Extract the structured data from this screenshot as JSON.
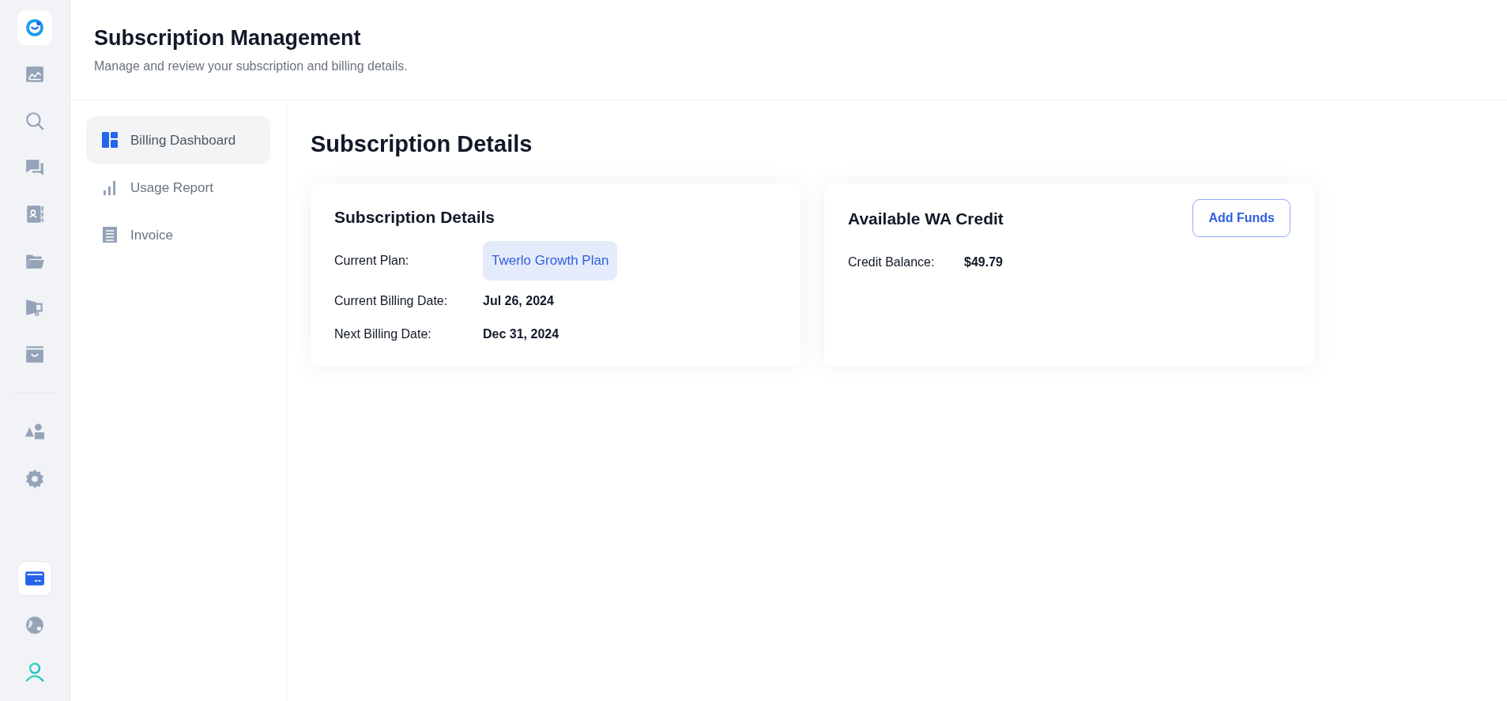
{
  "rail": {
    "top_items": [
      {
        "selected": false
      },
      {
        "selected": false
      },
      {
        "selected": false
      },
      {
        "selected": false
      },
      {
        "selected": false
      },
      {
        "selected": false
      },
      {
        "selected": false
      }
    ],
    "middle_items": [
      {
        "selected": false
      },
      {
        "selected": false
      }
    ],
    "bottom_items": [
      {
        "selected": true
      },
      {
        "selected": false
      },
      {
        "selected": false
      }
    ]
  },
  "header": {
    "title": "Subscription Management",
    "subtitle": "Manage and review your subscription and billing details."
  },
  "submenu": [
    {
      "label": "Billing Dashboard",
      "selected": true
    },
    {
      "label": "Usage Report",
      "selected": false
    },
    {
      "label": "Invoice",
      "selected": false
    }
  ],
  "page_title": "Subscription Details",
  "subscription_card": {
    "title": "Subscription Details",
    "rows": [
      {
        "label": "Current Plan:",
        "value": "Twerlo Growth Plan",
        "kind": "pill"
      },
      {
        "label": "Current Billing Date:",
        "value": "Jul 26, 2024",
        "kind": "text"
      },
      {
        "label": "Next Billing Date:",
        "value": "Dec 31, 2024",
        "kind": "text"
      }
    ]
  },
  "credit_card": {
    "title": "Available WA Credit",
    "button": "Add Funds",
    "label": "Credit Balance:",
    "value": "$49.79"
  }
}
